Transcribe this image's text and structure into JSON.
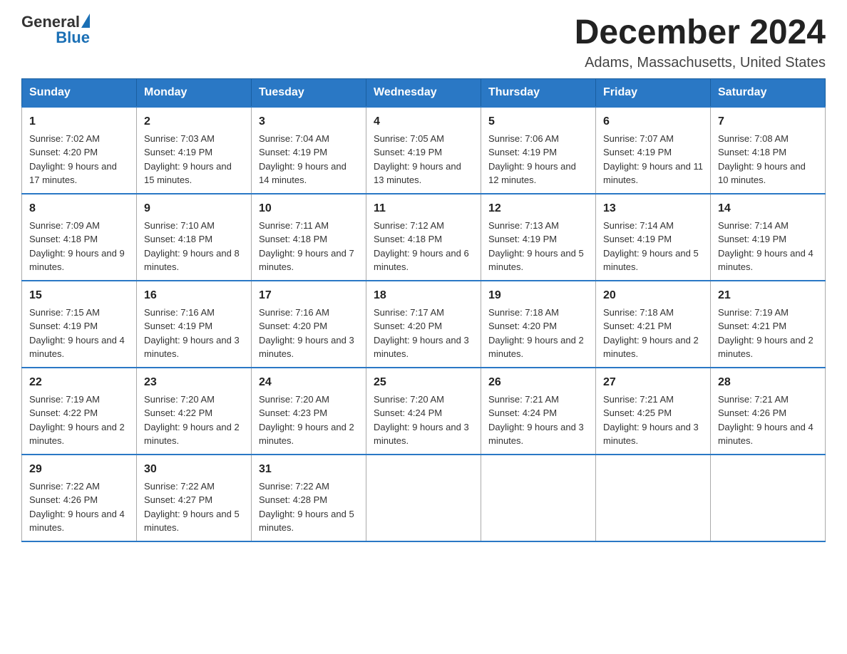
{
  "header": {
    "logo_general": "General",
    "logo_blue": "Blue",
    "month_title": "December 2024",
    "location": "Adams, Massachusetts, United States"
  },
  "weekdays": [
    "Sunday",
    "Monday",
    "Tuesday",
    "Wednesday",
    "Thursday",
    "Friday",
    "Saturday"
  ],
  "weeks": [
    [
      {
        "day": "1",
        "sunrise": "7:02 AM",
        "sunset": "4:20 PM",
        "daylight": "9 hours and 17 minutes."
      },
      {
        "day": "2",
        "sunrise": "7:03 AM",
        "sunset": "4:19 PM",
        "daylight": "9 hours and 15 minutes."
      },
      {
        "day": "3",
        "sunrise": "7:04 AM",
        "sunset": "4:19 PM",
        "daylight": "9 hours and 14 minutes."
      },
      {
        "day": "4",
        "sunrise": "7:05 AM",
        "sunset": "4:19 PM",
        "daylight": "9 hours and 13 minutes."
      },
      {
        "day": "5",
        "sunrise": "7:06 AM",
        "sunset": "4:19 PM",
        "daylight": "9 hours and 12 minutes."
      },
      {
        "day": "6",
        "sunrise": "7:07 AM",
        "sunset": "4:19 PM",
        "daylight": "9 hours and 11 minutes."
      },
      {
        "day": "7",
        "sunrise": "7:08 AM",
        "sunset": "4:18 PM",
        "daylight": "9 hours and 10 minutes."
      }
    ],
    [
      {
        "day": "8",
        "sunrise": "7:09 AM",
        "sunset": "4:18 PM",
        "daylight": "9 hours and 9 minutes."
      },
      {
        "day": "9",
        "sunrise": "7:10 AM",
        "sunset": "4:18 PM",
        "daylight": "9 hours and 8 minutes."
      },
      {
        "day": "10",
        "sunrise": "7:11 AM",
        "sunset": "4:18 PM",
        "daylight": "9 hours and 7 minutes."
      },
      {
        "day": "11",
        "sunrise": "7:12 AM",
        "sunset": "4:18 PM",
        "daylight": "9 hours and 6 minutes."
      },
      {
        "day": "12",
        "sunrise": "7:13 AM",
        "sunset": "4:19 PM",
        "daylight": "9 hours and 5 minutes."
      },
      {
        "day": "13",
        "sunrise": "7:14 AM",
        "sunset": "4:19 PM",
        "daylight": "9 hours and 5 minutes."
      },
      {
        "day": "14",
        "sunrise": "7:14 AM",
        "sunset": "4:19 PM",
        "daylight": "9 hours and 4 minutes."
      }
    ],
    [
      {
        "day": "15",
        "sunrise": "7:15 AM",
        "sunset": "4:19 PM",
        "daylight": "9 hours and 4 minutes."
      },
      {
        "day": "16",
        "sunrise": "7:16 AM",
        "sunset": "4:19 PM",
        "daylight": "9 hours and 3 minutes."
      },
      {
        "day": "17",
        "sunrise": "7:16 AM",
        "sunset": "4:20 PM",
        "daylight": "9 hours and 3 minutes."
      },
      {
        "day": "18",
        "sunrise": "7:17 AM",
        "sunset": "4:20 PM",
        "daylight": "9 hours and 3 minutes."
      },
      {
        "day": "19",
        "sunrise": "7:18 AM",
        "sunset": "4:20 PM",
        "daylight": "9 hours and 2 minutes."
      },
      {
        "day": "20",
        "sunrise": "7:18 AM",
        "sunset": "4:21 PM",
        "daylight": "9 hours and 2 minutes."
      },
      {
        "day": "21",
        "sunrise": "7:19 AM",
        "sunset": "4:21 PM",
        "daylight": "9 hours and 2 minutes."
      }
    ],
    [
      {
        "day": "22",
        "sunrise": "7:19 AM",
        "sunset": "4:22 PM",
        "daylight": "9 hours and 2 minutes."
      },
      {
        "day": "23",
        "sunrise": "7:20 AM",
        "sunset": "4:22 PM",
        "daylight": "9 hours and 2 minutes."
      },
      {
        "day": "24",
        "sunrise": "7:20 AM",
        "sunset": "4:23 PM",
        "daylight": "9 hours and 2 minutes."
      },
      {
        "day": "25",
        "sunrise": "7:20 AM",
        "sunset": "4:24 PM",
        "daylight": "9 hours and 3 minutes."
      },
      {
        "day": "26",
        "sunrise": "7:21 AM",
        "sunset": "4:24 PM",
        "daylight": "9 hours and 3 minutes."
      },
      {
        "day": "27",
        "sunrise": "7:21 AM",
        "sunset": "4:25 PM",
        "daylight": "9 hours and 3 minutes."
      },
      {
        "day": "28",
        "sunrise": "7:21 AM",
        "sunset": "4:26 PM",
        "daylight": "9 hours and 4 minutes."
      }
    ],
    [
      {
        "day": "29",
        "sunrise": "7:22 AM",
        "sunset": "4:26 PM",
        "daylight": "9 hours and 4 minutes."
      },
      {
        "day": "30",
        "sunrise": "7:22 AM",
        "sunset": "4:27 PM",
        "daylight": "9 hours and 5 minutes."
      },
      {
        "day": "31",
        "sunrise": "7:22 AM",
        "sunset": "4:28 PM",
        "daylight": "9 hours and 5 minutes."
      },
      null,
      null,
      null,
      null
    ]
  ]
}
